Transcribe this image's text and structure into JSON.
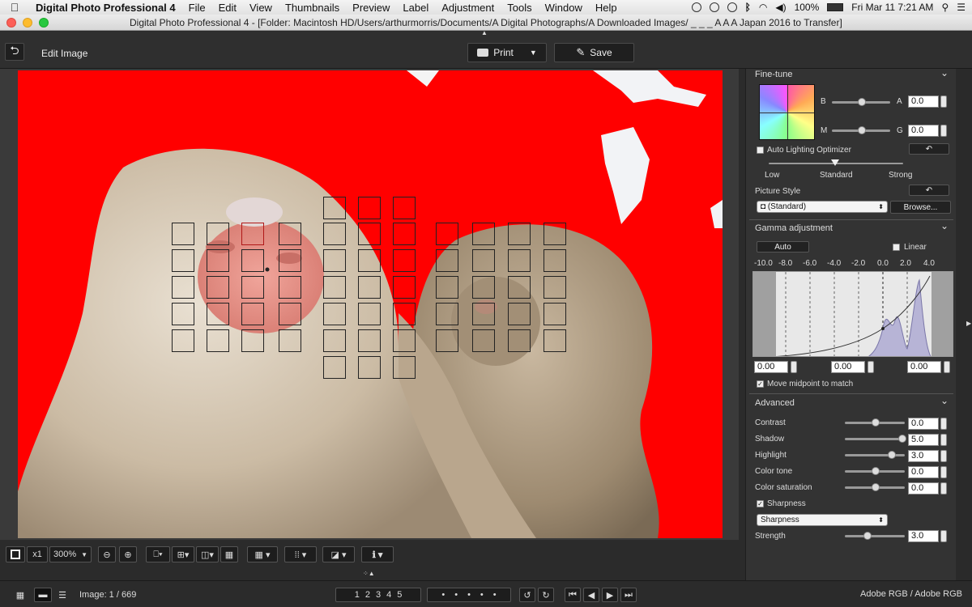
{
  "menubar": {
    "app": "Digital Photo Professional 4",
    "items": [
      "File",
      "Edit",
      "View",
      "Thumbnails",
      "Preview",
      "Label",
      "Adjustment",
      "Tools",
      "Window",
      "Help"
    ],
    "battery": "100%",
    "clock": "Fri Mar 11  7:21 AM"
  },
  "window": {
    "title": "Digital Photo Professional 4 - [Folder: Macintosh HD/Users/arthurmorris/Documents/A Digital Photographs/A Downloaded Images/ _ _ _ A A A Japan 2016 to Transfer]"
  },
  "toolbar": {
    "mode_label": "Edit Image",
    "print_label": "Print",
    "save_label": "Save"
  },
  "fine_tune": {
    "title": "Fine-tune",
    "b_label": "B",
    "a_label": "A",
    "m_label": "M",
    "g_label": "G",
    "ba_value": "0.0",
    "mg_value": "0.0",
    "alo_label": "Auto Lighting Optimizer",
    "alo_levels": [
      "Low",
      "Standard",
      "Strong"
    ],
    "picture_style_label": "Picture Style",
    "picture_style_value": "(Standard)",
    "browse_label": "Browse..."
  },
  "gamma": {
    "title": "Gamma adjustment",
    "auto_label": "Auto",
    "linear_label": "Linear",
    "scale": [
      "-10.0",
      "-8.0",
      "-6.0",
      "-4.0",
      "-2.0",
      "0.0",
      "2.0",
      "4.0"
    ],
    "black_point": "0.00",
    "midpoint": "0.00",
    "white_point": "0.00",
    "move_midpoint_label": "Move midpoint to match"
  },
  "advanced": {
    "title": "Advanced",
    "rows": [
      {
        "label": "Contrast",
        "value": "0.0",
        "level": 0.5
      },
      {
        "label": "Shadow",
        "value": "5.0",
        "level": 1.0
      },
      {
        "label": "Highlight",
        "value": "3.0",
        "level": 0.8
      },
      {
        "label": "Color tone",
        "value": "0.0",
        "level": 0.5
      },
      {
        "label": "Color saturation",
        "value": "0.0",
        "level": 0.5
      }
    ],
    "sharpness_label": "Sharpness",
    "sharpness_mode": "Sharpness",
    "strength_label": "Strength",
    "strength_value": "3.0",
    "strength_level": 0.35
  },
  "zoombar": {
    "zoom_x1": "x1",
    "zoom_value": "300%"
  },
  "statusbar": {
    "image_counter": "Image: 1 / 669",
    "ratings": [
      "1",
      "2",
      "3",
      "4",
      "5"
    ],
    "color_space": "Adobe RGB / Adobe RGB"
  },
  "colors": {
    "highlight_warning": "#ff0000",
    "panel_bg": "#333333",
    "app_bg": "#2b2b2b"
  }
}
